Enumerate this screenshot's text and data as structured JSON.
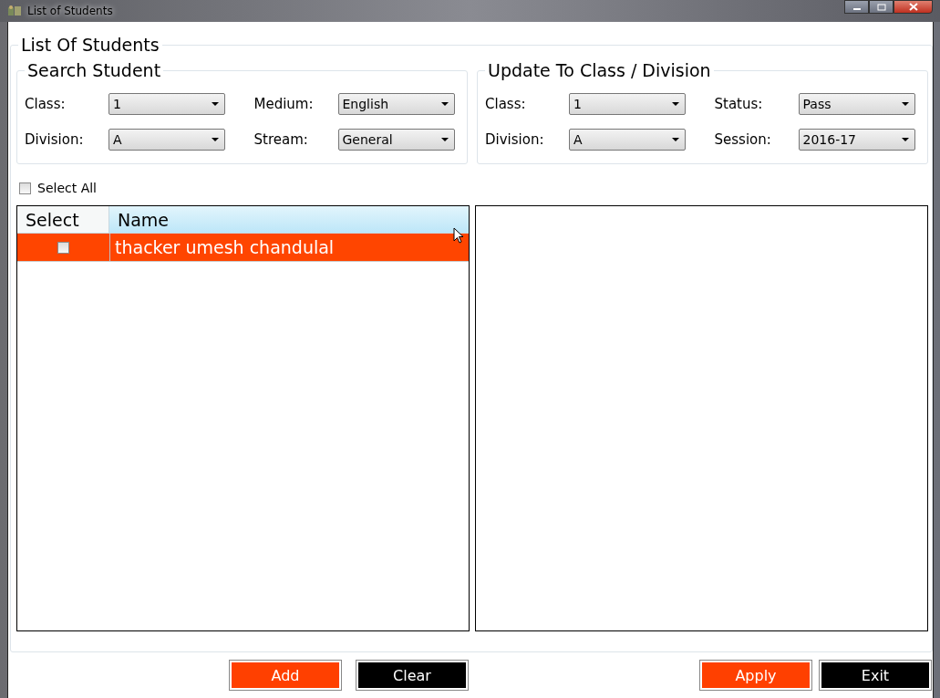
{
  "window": {
    "title": "List of Students"
  },
  "panel": {
    "title": "List Of Students"
  },
  "search_student": {
    "title": "Search Student",
    "fields": [
      {
        "label": "Class:",
        "value": "1"
      },
      {
        "label": "Medium:",
        "value": "English"
      },
      {
        "label": "Division:",
        "value": "A"
      },
      {
        "label": "Stream:",
        "value": "General"
      }
    ]
  },
  "update_to": {
    "title": "Update To Class / Division",
    "fields": [
      {
        "label": "Class:",
        "value": "1"
      },
      {
        "label": "Status:",
        "value": "Pass"
      },
      {
        "label": "Division:",
        "value": "A"
      },
      {
        "label": "Session:",
        "value": "2016-17"
      }
    ]
  },
  "select_all": {
    "label": "Select All",
    "checked": false
  },
  "table": {
    "columns": [
      "Select",
      "Name"
    ],
    "rows": [
      {
        "checked": false,
        "name": "thacker umesh chandulal",
        "selected": true
      }
    ]
  },
  "buttons": [
    {
      "label": "Add",
      "kind": "accent"
    },
    {
      "label": "Clear",
      "kind": "dark"
    },
    {
      "label": "Apply",
      "kind": "accent"
    },
    {
      "label": "Exit",
      "kind": "dark"
    }
  ]
}
